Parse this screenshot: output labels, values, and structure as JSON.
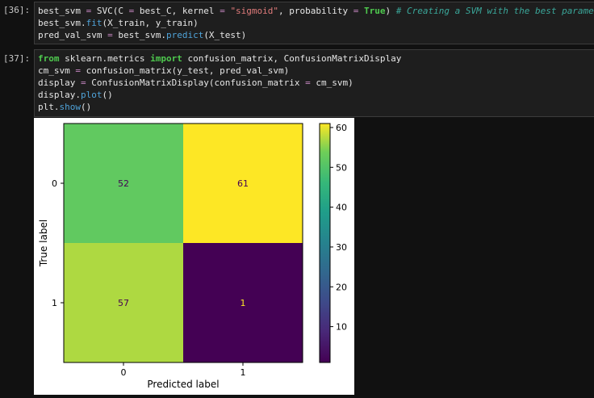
{
  "cells": [
    {
      "prompt": "[36]:",
      "lines": [
        [
          [
            "best_svm ",
            "plain"
          ],
          [
            "=",
            "op"
          ],
          [
            " SVC(C ",
            "plain"
          ],
          [
            "=",
            "op"
          ],
          [
            " best_C, kernel ",
            "plain"
          ],
          [
            "=",
            "op"
          ],
          [
            " ",
            "plain"
          ],
          [
            "\"sigmoid\"",
            "str"
          ],
          [
            ", probability ",
            "plain"
          ],
          [
            "=",
            "op"
          ],
          [
            " ",
            "plain"
          ],
          [
            "True",
            "kw2"
          ],
          [
            ") ",
            "plain"
          ],
          [
            "# Creating a SVM with the best parameters.",
            "cmt"
          ]
        ],
        [
          [
            "best_svm.",
            "plain"
          ],
          [
            "fit",
            "fn"
          ],
          [
            "(X_train, y_train)",
            "plain"
          ]
        ],
        [
          [
            "pred_val_svm ",
            "plain"
          ],
          [
            "=",
            "op"
          ],
          [
            " best_svm.",
            "plain"
          ],
          [
            "predict",
            "fn"
          ],
          [
            "(X_test)",
            "plain"
          ]
        ]
      ]
    },
    {
      "prompt": "[37]:",
      "lines": [
        [
          [
            "from",
            "kw2"
          ],
          [
            " sklearn.metrics ",
            "plain"
          ],
          [
            "import",
            "kw2"
          ],
          [
            " confusion_matrix, ConfusionMatrixDisplay",
            "plain"
          ]
        ],
        [
          [
            "cm_svm ",
            "plain"
          ],
          [
            "=",
            "op"
          ],
          [
            " confusion_matrix(y_test, pred_val_svm)",
            "plain"
          ]
        ],
        [
          [
            "display ",
            "plain"
          ],
          [
            "=",
            "op"
          ],
          [
            " ConfusionMatrixDisplay(confusion_matrix ",
            "plain"
          ],
          [
            "=",
            "op"
          ],
          [
            " cm_svm)",
            "plain"
          ]
        ],
        [
          [
            "display.",
            "plain"
          ],
          [
            "plot",
            "fn"
          ],
          [
            "()",
            "plain"
          ]
        ],
        [
          [
            "plt.",
            "plain"
          ],
          [
            "show",
            "fn"
          ],
          [
            "()",
            "plain"
          ]
        ]
      ]
    }
  ],
  "chart_data": {
    "type": "heatmap",
    "title": "",
    "xlabel": "Predicted label",
    "ylabel": "True label",
    "x_tick_labels": [
      "0",
      "1"
    ],
    "y_tick_labels": [
      "0",
      "1"
    ],
    "matrix": [
      [
        52,
        61
      ],
      [
        57,
        1
      ]
    ],
    "colormap": "viridis",
    "colorbar_ticks": [
      "10",
      "20",
      "30",
      "40",
      "50",
      "60"
    ],
    "colorbar_range": [
      1,
      61
    ],
    "colors": {
      "text_dark": "#440154",
      "text_light": "#fde725"
    }
  }
}
